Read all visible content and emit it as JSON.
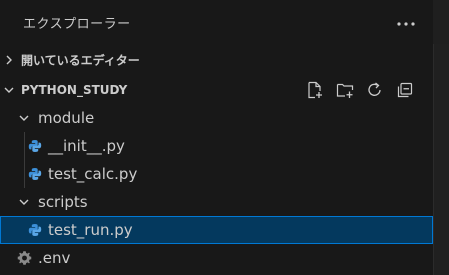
{
  "explorer": {
    "title": "エクスプローラー",
    "more_icon": "ellipsis-icon"
  },
  "open_editors": {
    "label": "開いているエディター",
    "collapsed": true
  },
  "workspace": {
    "label": "PYTHON_STUDY",
    "expanded": true,
    "actions": [
      {
        "name": "new-file-icon"
      },
      {
        "name": "new-folder-icon"
      },
      {
        "name": "refresh-icon"
      },
      {
        "name": "collapse-all-icon"
      }
    ]
  },
  "tree": {
    "module_folder": "module",
    "module_files": [
      "__init__.py",
      "test_calc.py"
    ],
    "scripts_folder": "scripts",
    "scripts_files": [
      "test_run.py"
    ],
    "root_files": [
      ".env"
    ]
  },
  "colors": {
    "background": "#181818",
    "selection": "#04395e",
    "selection_border": "#0078d4",
    "python_blue": "#3c8fd8",
    "text": "#cccccc"
  }
}
